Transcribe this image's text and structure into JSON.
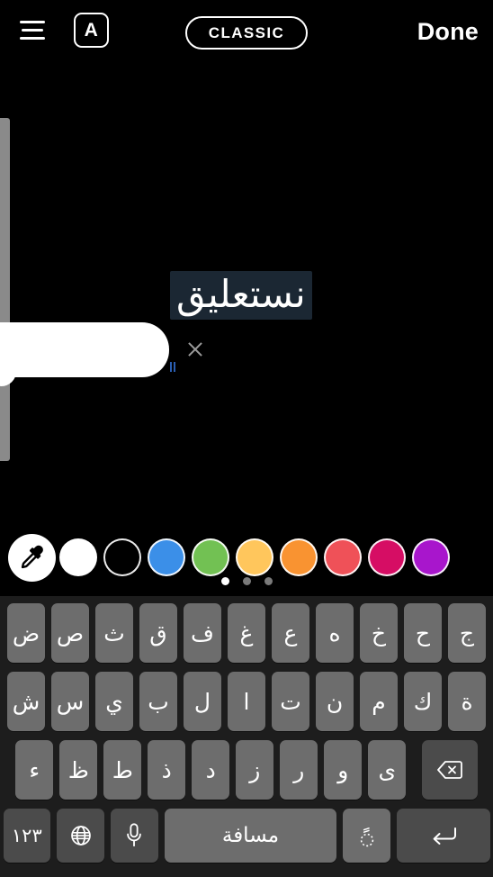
{
  "topbar": {
    "menu_icon": "hamburger-icon",
    "font_button_label": "A",
    "style_pill_label": "CLASSIC",
    "done_label": "Done"
  },
  "canvas": {
    "text_value": "نستعليق",
    "text_color": "#ffffff",
    "selection_color": "#1b2733",
    "popup_close_icon": "close-icon",
    "popup_background": "#ffffff",
    "tick_color": "#2a5db0"
  },
  "slider": {
    "track_color": "#8a8a8a",
    "thumb_color": "#ffffff",
    "value_label": ""
  },
  "colors": {
    "eyedropper_icon": "eyedropper-icon",
    "swatches": [
      {
        "name": "white",
        "hex": "#ffffff"
      },
      {
        "name": "black",
        "hex": "#000000"
      },
      {
        "name": "blue",
        "hex": "#3b8fe8"
      },
      {
        "name": "green",
        "hex": "#72c153"
      },
      {
        "name": "yellow",
        "hex": "#ffc65c"
      },
      {
        "name": "orange",
        "hex": "#f99331"
      },
      {
        "name": "red",
        "hex": "#ef5158"
      },
      {
        "name": "magenta",
        "hex": "#d60d64"
      },
      {
        "name": "purple",
        "hex": "#a816cc"
      }
    ],
    "page_dots": 3,
    "active_dot": 0
  },
  "keyboard": {
    "language": "Arabic",
    "row1": [
      "ض",
      "ص",
      "ث",
      "ق",
      "ف",
      "غ",
      "ع",
      "ه",
      "خ",
      "ح",
      "ج"
    ],
    "row2": [
      "ش",
      "س",
      "ي",
      "ب",
      "ل",
      "ا",
      "ت",
      "ن",
      "م",
      "ك",
      "ة"
    ],
    "row3": [
      "ء",
      "ظ",
      "ط",
      "ذ",
      "د",
      "ز",
      "ر",
      "و",
      "ى"
    ],
    "backspace_icon": "backspace-icon",
    "numbers_label": "١٢٣",
    "globe_icon": "globe-icon",
    "mic_icon": "microphone-icon",
    "space_label": "مسافة",
    "diacritic_label": "ؘؚ۟",
    "return_icon": "return-icon",
    "key_color": "#6d6d6d",
    "fn_key_color": "#4b4b4b",
    "background": "#1d1d1d"
  }
}
